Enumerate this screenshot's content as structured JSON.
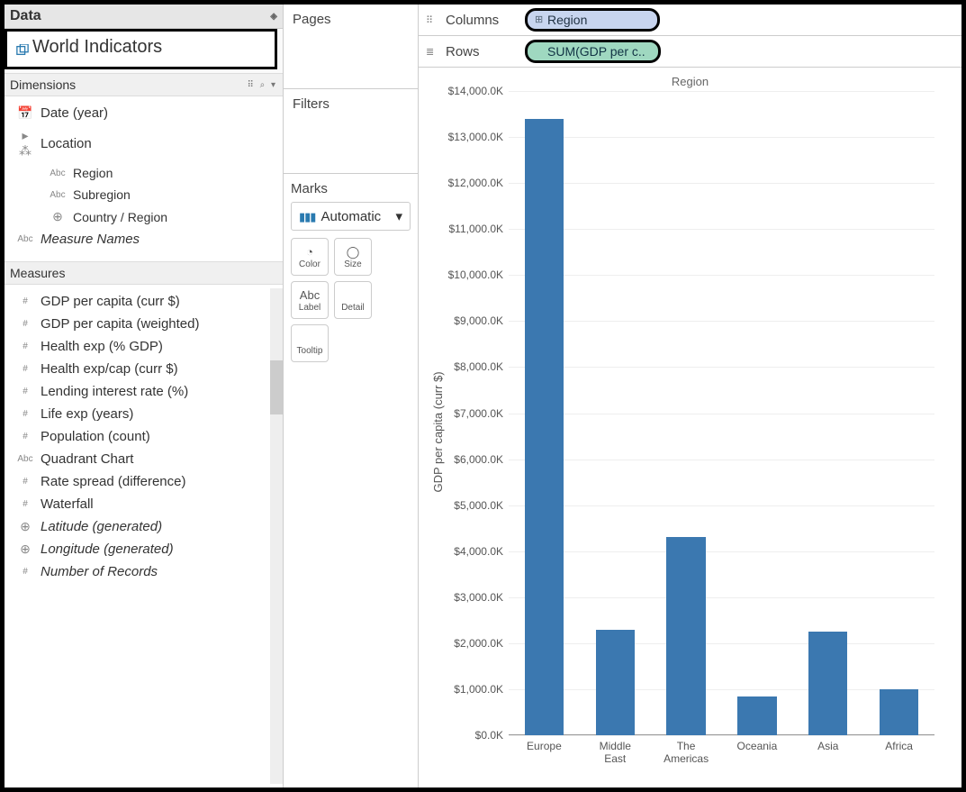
{
  "data_tab": {
    "title": "Data",
    "datasource": "World Indicators"
  },
  "dimensions": {
    "title": "Dimensions",
    "tools": "⠿ ⌕ ▾",
    "items": [
      {
        "icon": "date",
        "label": "Date (year)",
        "indent": 0
      },
      {
        "icon": "hier",
        "label": "Location",
        "indent": 0
      },
      {
        "icon": "abc",
        "label": "Region",
        "indent": 2
      },
      {
        "icon": "abc",
        "label": "Subregion",
        "indent": 2
      },
      {
        "icon": "geo",
        "label": "Country / Region",
        "indent": 2
      },
      {
        "icon": "abc",
        "label": "Measure Names",
        "indent": 0,
        "italic": true
      }
    ]
  },
  "measures": {
    "title": "Measures",
    "items": [
      {
        "icon": "#",
        "label": "GDP per capita (curr $)"
      },
      {
        "icon": "#",
        "label": "GDP per capita (weighted)"
      },
      {
        "icon": "#",
        "label": "Health exp (% GDP)"
      },
      {
        "icon": "#",
        "label": "Health exp/cap (curr $)"
      },
      {
        "icon": "#",
        "label": "Lending interest rate (%)"
      },
      {
        "icon": "#",
        "label": "Life exp (years)"
      },
      {
        "icon": "#",
        "label": "Population (count)"
      },
      {
        "icon": "abc",
        "label": "Quadrant Chart"
      },
      {
        "icon": "#",
        "label": "Rate spread (difference)"
      },
      {
        "icon": "#",
        "label": "Waterfall"
      },
      {
        "icon": "geo",
        "label": "Latitude (generated)",
        "italic": true
      },
      {
        "icon": "geo",
        "label": "Longitude (generated)",
        "italic": true
      },
      {
        "icon": "#",
        "label": "Number of Records",
        "italic": true
      }
    ]
  },
  "shelves": {
    "pages": "Pages",
    "filters": "Filters",
    "marks": {
      "title": "Marks",
      "type": "Automatic",
      "cards": [
        {
          "name": "color",
          "label": "Color",
          "icon": "◔"
        },
        {
          "name": "size",
          "label": "Size",
          "icon": "◯"
        },
        {
          "name": "label",
          "label": "Label",
          "icon": "Abc"
        },
        {
          "name": "detail",
          "label": "Detail",
          "icon": ""
        },
        {
          "name": "tooltip",
          "label": "Tooltip",
          "icon": ""
        }
      ]
    }
  },
  "colrow": {
    "columns_label": "Columns",
    "rows_label": "Rows",
    "columns_pill": "Region",
    "rows_pill": "SUM(GDP per c.."
  },
  "chart_data": {
    "type": "bar",
    "title": "Region",
    "ylabel": "GDP per capita (curr $)",
    "categories": [
      "Europe",
      "Middle East",
      "The Americas",
      "Oceania",
      "Asia",
      "Africa"
    ],
    "category_display": [
      "Europe",
      "Middle\nEast",
      "The\nAmericas",
      "Oceania",
      "Asia",
      "Africa"
    ],
    "values": [
      13400,
      2300,
      4300,
      850,
      2250,
      1000
    ],
    "ylim": [
      0,
      14000
    ],
    "yticks": [
      0,
      1000,
      2000,
      3000,
      4000,
      5000,
      6000,
      7000,
      8000,
      9000,
      10000,
      11000,
      12000,
      13000,
      14000
    ],
    "ytick_labels": [
      "$0.0K",
      "$1,000.0K",
      "$2,000.0K",
      "$3,000.0K",
      "$4,000.0K",
      "$5,000.0K",
      "$6,000.0K",
      "$7,000.0K",
      "$8,000.0K",
      "$9,000.0K",
      "$10,000.0K",
      "$11,000.0K",
      "$12,000.0K",
      "$13,000.0K",
      "$14,000.0K"
    ]
  }
}
